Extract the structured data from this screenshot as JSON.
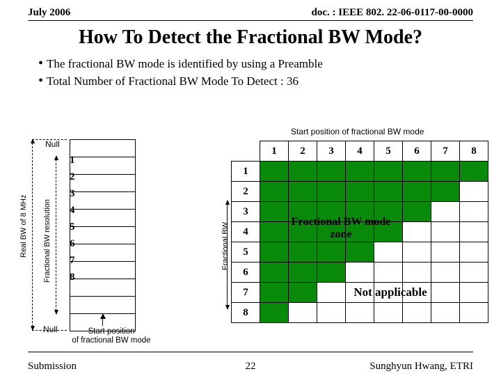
{
  "header": {
    "left": "July 2006",
    "right": "doc. : IEEE 802. 22-06-0117-00-0000"
  },
  "title": "How To Detect the Fractional BW Mode?",
  "bullets": [
    "The fractional BW mode is identified by using a Preamble",
    "Total Number of Fractional BW Mode To Detect : 36"
  ],
  "left_diagram": {
    "null_label": "Null",
    "row_numbers": [
      "1",
      "2",
      "3",
      "4",
      "5",
      "6",
      "7",
      "8"
    ],
    "real_bw_label": "Real BW of 8 MHz",
    "frac_res_label": "Fractional BW resolution",
    "start_pos_label": "Start position\nof fractional BW mode"
  },
  "matrix": {
    "caption": "Start position of fractional BW mode",
    "frac_bw_label": "Fractional BW",
    "col_headers": [
      "1",
      "2",
      "3",
      "4",
      "5",
      "6",
      "7",
      "8"
    ],
    "row_headers": [
      "1",
      "2",
      "3",
      "4",
      "5",
      "6",
      "7",
      "8"
    ],
    "zone_label": "Fractional BW mode zone",
    "na_label": "Not applicable"
  },
  "footer": {
    "left": "Submission",
    "center": "22",
    "right": "Sunghyun Hwang, ETRI"
  }
}
